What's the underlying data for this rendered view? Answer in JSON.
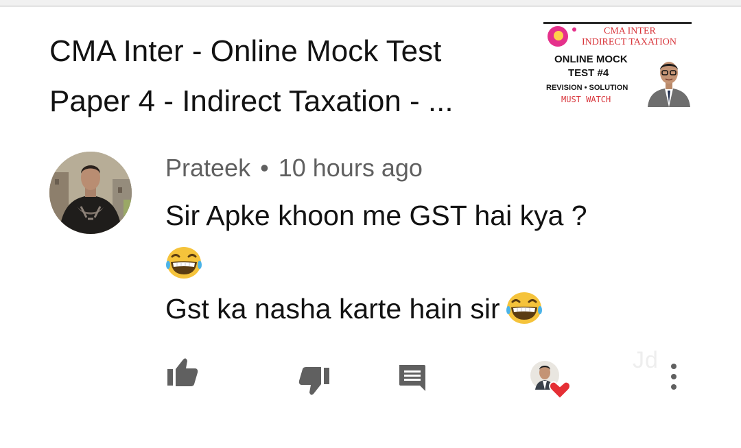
{
  "video": {
    "title_line1": "CMA Inter - Online Mock Test",
    "title_line2": "Paper 4 - Indirect Taxation - ...",
    "thumbnail": {
      "header_line1": "CMA INTER",
      "header_line2": "INDIRECT TAXATION",
      "mock_line1": "ONLINE MOCK",
      "mock_line2": "TEST #4",
      "sub_line": "REVISION • SOLUTION",
      "cta_line": "MUST WATCH"
    }
  },
  "comment": {
    "author": "Prateek",
    "separator": "•",
    "timestamp": "10 hours ago",
    "text_line1": "Sir Apke khoon me GST hai kya ?",
    "emoji_line2": "laughing-face",
    "reply_line": "Gst ka nasha karte hain sir",
    "reply_emoji": "laughing-face"
  },
  "actions": {
    "like_icon": "thumbs-up-icon",
    "dislike_icon": "thumbs-down-icon",
    "reply_icon": "comment-icon",
    "creator_heart": "creator-heart-icon",
    "more_icon": "more-vert-icon"
  },
  "watermark": "Jd",
  "colors": {
    "heart": "#e52f35",
    "emoji_yellow": "#f5c33b",
    "meta_text": "#606060",
    "icon_gray": "#606060"
  }
}
